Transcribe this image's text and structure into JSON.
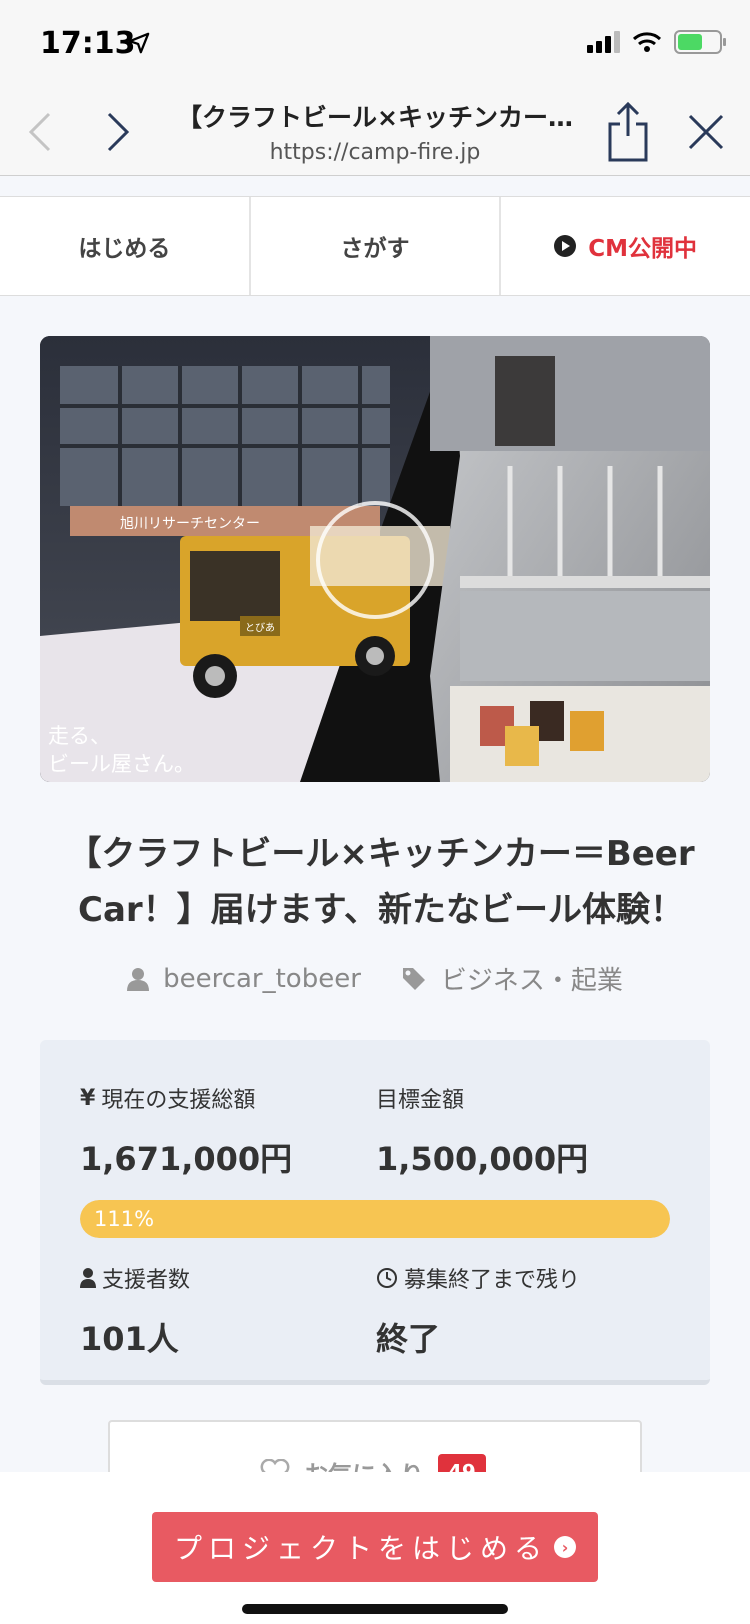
{
  "status_bar": {
    "time": "17:13"
  },
  "browser": {
    "page_title": "【クラフトビール×キッチンカー…",
    "url": "https://camp-fire.jp"
  },
  "site_tabs": [
    {
      "label": "はじめる"
    },
    {
      "label": "さがす"
    },
    {
      "label": "CM公開中"
    }
  ],
  "hero": {
    "caption_line1": "走る、",
    "caption_line2": "ビール屋さん。",
    "sign_text": "旭川リサーチセンター",
    "truck_text": "とびあ"
  },
  "project": {
    "title": "【クラフトビール×キッチンカー＝Beer Car！】届けます、新たなビール体験！",
    "owner": "beercar_tobeer",
    "category": "ビジネス・起業"
  },
  "stats": {
    "current_label": "現在の支援総額",
    "current_value": "1,671,000円",
    "goal_label": "目標金額",
    "goal_value": "1,500,000円",
    "progress_text": "111%",
    "progress_fraction": 1.0,
    "backers_label": "支援者数",
    "backers_value": "101人",
    "remaining_label": "募集終了まで残り",
    "remaining_value": "終了"
  },
  "favorite": {
    "label": "お気に入り",
    "count": "49"
  },
  "cta": {
    "label": "プロジェクトをはじめる"
  },
  "colors": {
    "accent_red": "#e0323c",
    "progress": "#f7c552",
    "cta": "#e85a62"
  }
}
